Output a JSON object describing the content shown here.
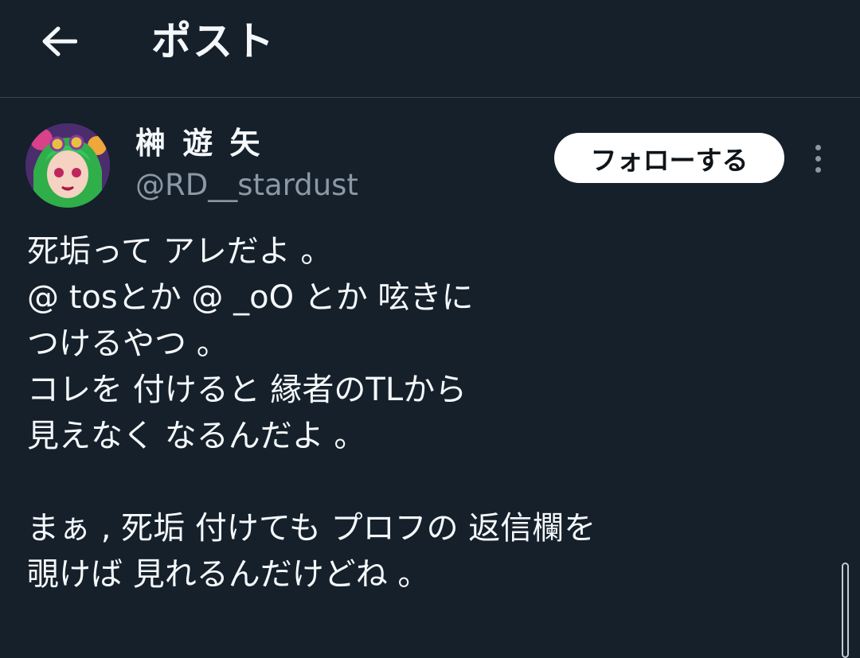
{
  "header": {
    "back_icon": "arrow-left-icon",
    "title": "ポスト"
  },
  "author": {
    "avatar_icon": "user-avatar",
    "display_name": "榊 遊 矢",
    "handle": "@RD__stardust"
  },
  "actions": {
    "follow_label": "フォローする",
    "more_icon": "more-vertical-icon"
  },
  "tweet": {
    "lines": [
      "死垢って アレだよ 。",
      "@ tosとか @ _oO とか 呟きに",
      "つけるやつ 。",
      "コレを 付けると 縁者のTLから",
      "見えなく なるんだよ 。",
      "",
      "まぁ , 死垢 付けても プロフの 返信欄を",
      "覗けば 見れるんだけどね 。"
    ]
  },
  "colors": {
    "background": "#15202b",
    "text": "#f5f8fa",
    "muted": "#8b98a5",
    "divider": "#38444d",
    "button_bg": "#ffffff"
  }
}
